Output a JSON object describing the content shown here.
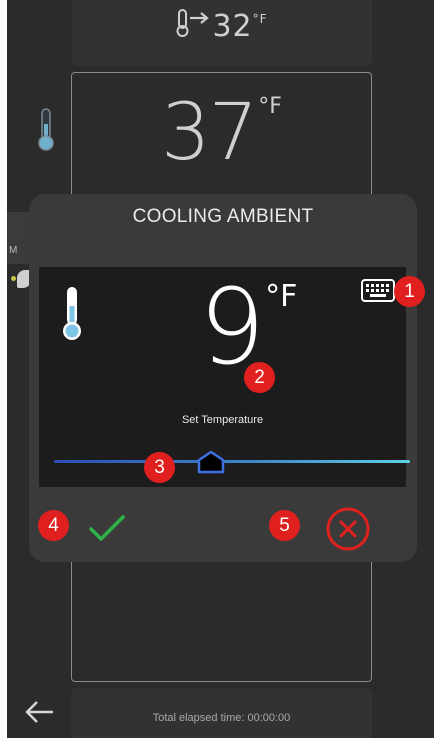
{
  "background": {
    "pull_temp": {
      "value": "32",
      "unit": "°F",
      "icon": "thermometer-arrow-icon"
    },
    "current_temp": {
      "value": "37",
      "unit": "°F"
    },
    "side_tab_letter": "M",
    "elapsed_text": "Total elapsed time: 00:00:00",
    "back_icon": "left-arrow-icon"
  },
  "dialog": {
    "title": "COOLING AMBIENT",
    "set_temp_value": "9",
    "set_temp_unit": "°F",
    "set_temp_label": "Set Temperature",
    "slider": {
      "level_fraction": 0.44,
      "colors": [
        "#2b4fb3",
        "#5fd0e5"
      ]
    },
    "keyboard_icon": "keyboard-icon",
    "confirm_icon": "checkmark-icon",
    "cancel_icon": "close-circle-icon"
  },
  "callouts": [
    "1",
    "2",
    "3",
    "4",
    "5"
  ],
  "colors": {
    "screen_bg": "#2b2b2b",
    "dialog_bg": "#3a3a3a",
    "panel_bg": "#1c1c1c",
    "confirm": "#2fb34a",
    "cancel": "#e0201e",
    "callout": "#e0201e",
    "thermometer_fill": "#7fc6e6"
  }
}
